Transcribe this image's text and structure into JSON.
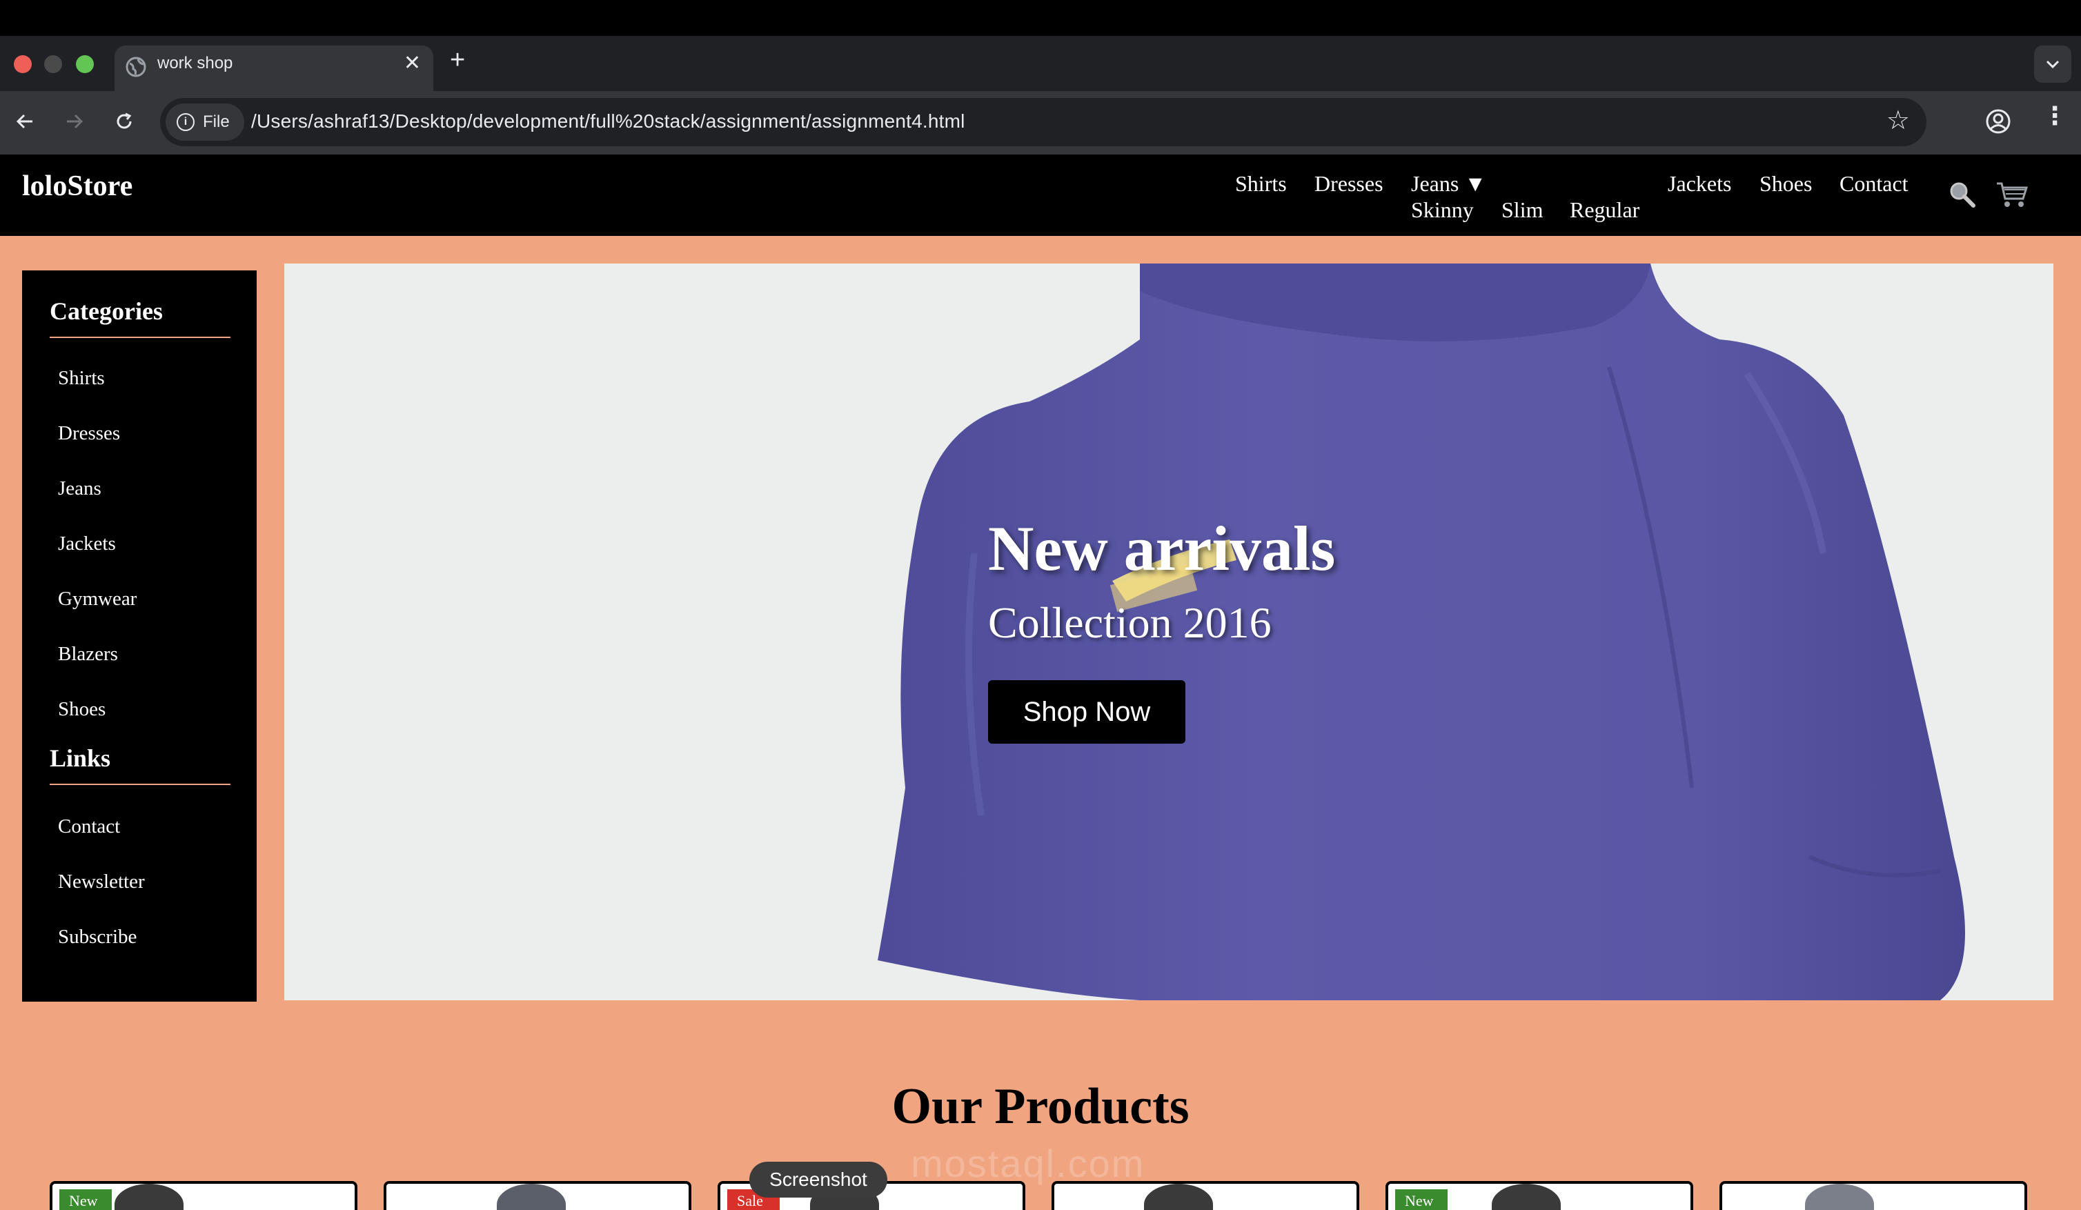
{
  "browser": {
    "tab_title": "work shop",
    "tab_close": "✕",
    "new_tab": "+",
    "tab_menu": "⌄",
    "site_info_label": "File",
    "url": "/Users/ashraf13/Desktop/development/full%20stack/assignment/assignment4.html"
  },
  "site": {
    "logo": "loloStore",
    "nav": {
      "shirts": "Shirts",
      "dresses": "Dresses",
      "jeans": "Jeans ▼",
      "jeans_sub": [
        "Skinny",
        "Slim",
        "Regular"
      ],
      "jackets": "Jackets",
      "shoes": "Shoes",
      "contact": "Contact"
    }
  },
  "sidebar": {
    "categories_heading": "Categories",
    "categories": [
      "Shirts",
      "Dresses",
      "Jeans",
      "Jackets",
      "Gymwear",
      "Blazers",
      "Shoes"
    ],
    "links_heading": "Links",
    "links": [
      "Contact",
      "Newsletter",
      "Subscribe"
    ]
  },
  "hero": {
    "title": "New arrivals",
    "subtitle": "Collection 2016",
    "button": "Shop Now"
  },
  "products": {
    "heading": "Our Products",
    "cards": [
      {
        "badge": "New"
      },
      {
        "badge": ""
      },
      {
        "badge": "Sale"
      },
      {
        "badge": ""
      },
      {
        "badge": "New"
      },
      {
        "badge": ""
      }
    ]
  },
  "overlay": {
    "tooltip": "Screenshot",
    "watermark": "mostaql.com"
  },
  "colors": {
    "page_bg": "#f0a47f",
    "nav_bg": "#000000",
    "shirt": "#5a58a6",
    "badge_new": "#3a8a2e",
    "badge_sale": "#d8312a"
  }
}
